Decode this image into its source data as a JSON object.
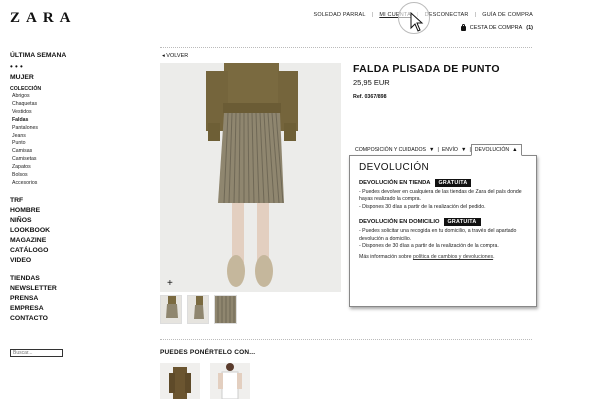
{
  "brand": {
    "logo_text": "ZARA"
  },
  "header": {
    "nav": [
      {
        "label": "SOLEDAD PARRAL",
        "highlight": false
      },
      {
        "label": "MI CUENTA",
        "highlight": true
      },
      {
        "label": "DESCONECTAR",
        "highlight": false
      },
      {
        "label": "GUÍA DE COMPRA",
        "highlight": false
      }
    ],
    "cart_label": "CESTA DE COMPRA",
    "cart_count": "(1)"
  },
  "sidebar": {
    "ultima_semana": "ÚLTIMA SEMANA",
    "dots": "• • •",
    "mujer": "MUJER",
    "coleccion": "COLECCIÓN",
    "items": [
      "Abrigos",
      "Chaquetas",
      "Vestidos",
      "Faldas",
      "Pantalones",
      "Jeans",
      "Punto",
      "Camisas",
      "Camisetas",
      "Zapatos",
      "Bolsos",
      "Accesorios"
    ],
    "active_item": "Faldas",
    "groups1": [
      "TRF",
      "HOMBRE",
      "NIÑOS",
      "LOOKBOOK",
      "MAGAZINE",
      "CATÁLOGO",
      "VIDEO"
    ],
    "groups2": [
      "TIENDAS",
      "NEWSLETTER",
      "PRENSA",
      "EMPRESA",
      "CONTACTO"
    ],
    "search_placeholder": "Buscar..."
  },
  "product": {
    "back_label": "VOLVER",
    "title": "FALDA PLISADA DE PUNTO",
    "price": "25,95 EUR",
    "ref": "Ref. 0367/898",
    "zoom_symbol": "+"
  },
  "tabs": [
    {
      "label": "COMPOSICIÓN Y CUIDADOS",
      "icon": "triangle-down-icon",
      "active": false
    },
    {
      "label": "ENVÍO",
      "icon": "triangle-down-icon",
      "active": false
    },
    {
      "label": "DEVOLUCIÓN",
      "icon": "triangle-up-icon",
      "active": true
    }
  ],
  "popup": {
    "title": "DEVOLUCIÓN",
    "tienda": {
      "heading": "DEVOLUCIÓN EN TIENDA",
      "badge": "GRATUITA",
      "line1": "- Puedes devolver en cualquiera de las tiendas de Zara del país donde hayas realizado la compra.",
      "line2": "- Dispones 30 días a partir de la realización del pedido."
    },
    "domicilio": {
      "heading": "DEVOLUCIÓN EN DOMICILIO",
      "badge": "GRATUITA",
      "line1": "- Puedes solicitar una recogida en tu domicilio, a través del apartado devolución a domicilio.",
      "line2": "- Dispones de 30 días a partir de la realización de la compra."
    },
    "more_prefix": "Más información sobre",
    "more_link": "política de cambios y devoluciones",
    "more_suffix": "."
  },
  "recommend": {
    "title": "PUEDES PONÉRTELO CON..."
  },
  "colors": {
    "text": "#111111",
    "badge_bg": "#111111",
    "photo_bg": "#ececea",
    "skirt": "#8f866f",
    "sweater": "#7a6a40"
  }
}
